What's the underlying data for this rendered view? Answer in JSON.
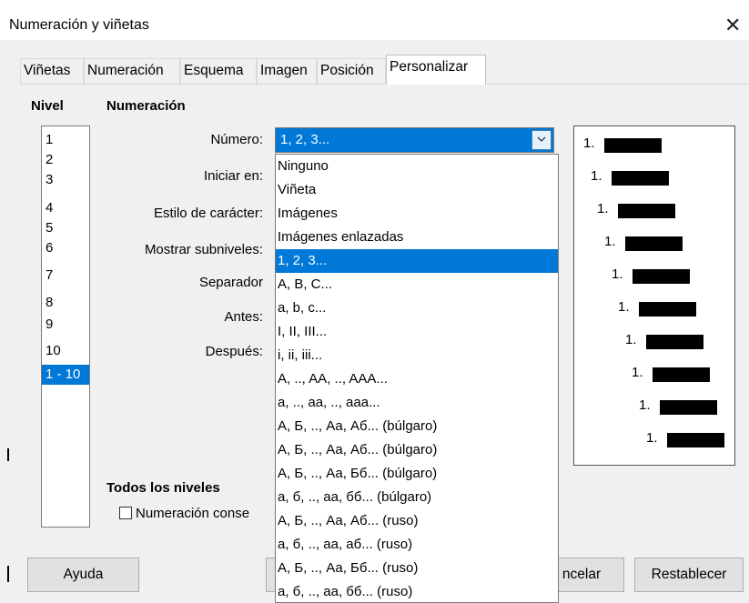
{
  "window": {
    "title": "Numeración y viñetas"
  },
  "tabs": [
    "Viñetas",
    "Numeración",
    "Esquema",
    "Imagen",
    "Posición",
    "Personalizar"
  ],
  "nivel": {
    "header": "Nivel",
    "items": [
      "1",
      "2",
      "3",
      "4",
      "5",
      "6",
      "7",
      "8",
      "9",
      "10",
      "1 - 10"
    ],
    "selected": "1 - 10"
  },
  "numeracion": {
    "header": "Numeración",
    "numero_label": "Número:",
    "iniciar_label": "Iniciar en:",
    "estilo_label": "Estilo de carácter:",
    "mostrar_label": "Mostrar subniveles:",
    "separador_label": "Separador",
    "antes_label": "Antes:",
    "despues_label": "Después:",
    "numero_value": "1, 2, 3..."
  },
  "dropdown": {
    "options": [
      "Ninguno",
      "Viñeta",
      "Imágenes",
      "Imágenes enlazadas",
      "1, 2, 3...",
      "A, B, C...",
      "a, b, c...",
      "I, II, III...",
      "i, ii, iii...",
      "A, .., AA, .., AAA...",
      "a, .., aa, .., aaa...",
      "А, Б, .., Аа, Аб... (búlgaro)",
      "А, Б, .., Аа, Аб... (búlgaro)",
      "А, Б, .., Аа, Бб... (búlgaro)",
      "а, б, .., аа, бб... (búlgaro)",
      "А, Б, .., Аа, Аб... (ruso)",
      "а, б, .., аа, аб... (ruso)",
      "А, Б, .., Аа, Бб... (ruso)",
      "а, б, .., аа, бб... (ruso)"
    ],
    "selected": "1, 2, 3..."
  },
  "preview": {
    "labels": [
      "1.",
      "1.",
      "1.",
      "1.",
      "1.",
      "1.",
      "1.",
      "1.",
      "1.",
      "1."
    ]
  },
  "todos": {
    "header": "Todos los niveles",
    "checkbox_label": "Numeración conse"
  },
  "buttons": {
    "ayuda": "Ayuda",
    "cancelar": "ncelar",
    "restablecer": "Restablecer"
  }
}
